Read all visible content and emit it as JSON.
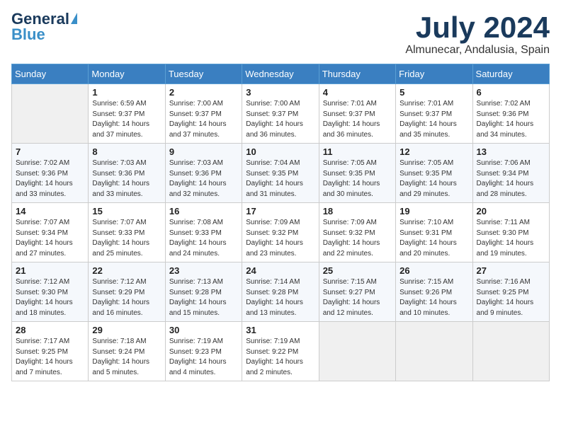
{
  "logo": {
    "general": "General",
    "blue": "Blue"
  },
  "title": "July 2024",
  "location": "Almunecar, Andalusia, Spain",
  "headers": [
    "Sunday",
    "Monday",
    "Tuesday",
    "Wednesday",
    "Thursday",
    "Friday",
    "Saturday"
  ],
  "weeks": [
    [
      {
        "day": "",
        "sunrise": "",
        "sunset": "",
        "daylight": ""
      },
      {
        "day": "1",
        "sunrise": "Sunrise: 6:59 AM",
        "sunset": "Sunset: 9:37 PM",
        "daylight": "Daylight: 14 hours and 37 minutes."
      },
      {
        "day": "2",
        "sunrise": "Sunrise: 7:00 AM",
        "sunset": "Sunset: 9:37 PM",
        "daylight": "Daylight: 14 hours and 37 minutes."
      },
      {
        "day": "3",
        "sunrise": "Sunrise: 7:00 AM",
        "sunset": "Sunset: 9:37 PM",
        "daylight": "Daylight: 14 hours and 36 minutes."
      },
      {
        "day": "4",
        "sunrise": "Sunrise: 7:01 AM",
        "sunset": "Sunset: 9:37 PM",
        "daylight": "Daylight: 14 hours and 36 minutes."
      },
      {
        "day": "5",
        "sunrise": "Sunrise: 7:01 AM",
        "sunset": "Sunset: 9:37 PM",
        "daylight": "Daylight: 14 hours and 35 minutes."
      },
      {
        "day": "6",
        "sunrise": "Sunrise: 7:02 AM",
        "sunset": "Sunset: 9:36 PM",
        "daylight": "Daylight: 14 hours and 34 minutes."
      }
    ],
    [
      {
        "day": "7",
        "sunrise": "Sunrise: 7:02 AM",
        "sunset": "Sunset: 9:36 PM",
        "daylight": "Daylight: 14 hours and 33 minutes."
      },
      {
        "day": "8",
        "sunrise": "Sunrise: 7:03 AM",
        "sunset": "Sunset: 9:36 PM",
        "daylight": "Daylight: 14 hours and 33 minutes."
      },
      {
        "day": "9",
        "sunrise": "Sunrise: 7:03 AM",
        "sunset": "Sunset: 9:36 PM",
        "daylight": "Daylight: 14 hours and 32 minutes."
      },
      {
        "day": "10",
        "sunrise": "Sunrise: 7:04 AM",
        "sunset": "Sunset: 9:35 PM",
        "daylight": "Daylight: 14 hours and 31 minutes."
      },
      {
        "day": "11",
        "sunrise": "Sunrise: 7:05 AM",
        "sunset": "Sunset: 9:35 PM",
        "daylight": "Daylight: 14 hours and 30 minutes."
      },
      {
        "day": "12",
        "sunrise": "Sunrise: 7:05 AM",
        "sunset": "Sunset: 9:35 PM",
        "daylight": "Daylight: 14 hours and 29 minutes."
      },
      {
        "day": "13",
        "sunrise": "Sunrise: 7:06 AM",
        "sunset": "Sunset: 9:34 PM",
        "daylight": "Daylight: 14 hours and 28 minutes."
      }
    ],
    [
      {
        "day": "14",
        "sunrise": "Sunrise: 7:07 AM",
        "sunset": "Sunset: 9:34 PM",
        "daylight": "Daylight: 14 hours and 27 minutes."
      },
      {
        "day": "15",
        "sunrise": "Sunrise: 7:07 AM",
        "sunset": "Sunset: 9:33 PM",
        "daylight": "Daylight: 14 hours and 25 minutes."
      },
      {
        "day": "16",
        "sunrise": "Sunrise: 7:08 AM",
        "sunset": "Sunset: 9:33 PM",
        "daylight": "Daylight: 14 hours and 24 minutes."
      },
      {
        "day": "17",
        "sunrise": "Sunrise: 7:09 AM",
        "sunset": "Sunset: 9:32 PM",
        "daylight": "Daylight: 14 hours and 23 minutes."
      },
      {
        "day": "18",
        "sunrise": "Sunrise: 7:09 AM",
        "sunset": "Sunset: 9:32 PM",
        "daylight": "Daylight: 14 hours and 22 minutes."
      },
      {
        "day": "19",
        "sunrise": "Sunrise: 7:10 AM",
        "sunset": "Sunset: 9:31 PM",
        "daylight": "Daylight: 14 hours and 20 minutes."
      },
      {
        "day": "20",
        "sunrise": "Sunrise: 7:11 AM",
        "sunset": "Sunset: 9:30 PM",
        "daylight": "Daylight: 14 hours and 19 minutes."
      }
    ],
    [
      {
        "day": "21",
        "sunrise": "Sunrise: 7:12 AM",
        "sunset": "Sunset: 9:30 PM",
        "daylight": "Daylight: 14 hours and 18 minutes."
      },
      {
        "day": "22",
        "sunrise": "Sunrise: 7:12 AM",
        "sunset": "Sunset: 9:29 PM",
        "daylight": "Daylight: 14 hours and 16 minutes."
      },
      {
        "day": "23",
        "sunrise": "Sunrise: 7:13 AM",
        "sunset": "Sunset: 9:28 PM",
        "daylight": "Daylight: 14 hours and 15 minutes."
      },
      {
        "day": "24",
        "sunrise": "Sunrise: 7:14 AM",
        "sunset": "Sunset: 9:28 PM",
        "daylight": "Daylight: 14 hours and 13 minutes."
      },
      {
        "day": "25",
        "sunrise": "Sunrise: 7:15 AM",
        "sunset": "Sunset: 9:27 PM",
        "daylight": "Daylight: 14 hours and 12 minutes."
      },
      {
        "day": "26",
        "sunrise": "Sunrise: 7:15 AM",
        "sunset": "Sunset: 9:26 PM",
        "daylight": "Daylight: 14 hours and 10 minutes."
      },
      {
        "day": "27",
        "sunrise": "Sunrise: 7:16 AM",
        "sunset": "Sunset: 9:25 PM",
        "daylight": "Daylight: 14 hours and 9 minutes."
      }
    ],
    [
      {
        "day": "28",
        "sunrise": "Sunrise: 7:17 AM",
        "sunset": "Sunset: 9:25 PM",
        "daylight": "Daylight: 14 hours and 7 minutes."
      },
      {
        "day": "29",
        "sunrise": "Sunrise: 7:18 AM",
        "sunset": "Sunset: 9:24 PM",
        "daylight": "Daylight: 14 hours and 5 minutes."
      },
      {
        "day": "30",
        "sunrise": "Sunrise: 7:19 AM",
        "sunset": "Sunset: 9:23 PM",
        "daylight": "Daylight: 14 hours and 4 minutes."
      },
      {
        "day": "31",
        "sunrise": "Sunrise: 7:19 AM",
        "sunset": "Sunset: 9:22 PM",
        "daylight": "Daylight: 14 hours and 2 minutes."
      },
      {
        "day": "",
        "sunrise": "",
        "sunset": "",
        "daylight": ""
      },
      {
        "day": "",
        "sunrise": "",
        "sunset": "",
        "daylight": ""
      },
      {
        "day": "",
        "sunrise": "",
        "sunset": "",
        "daylight": ""
      }
    ]
  ]
}
